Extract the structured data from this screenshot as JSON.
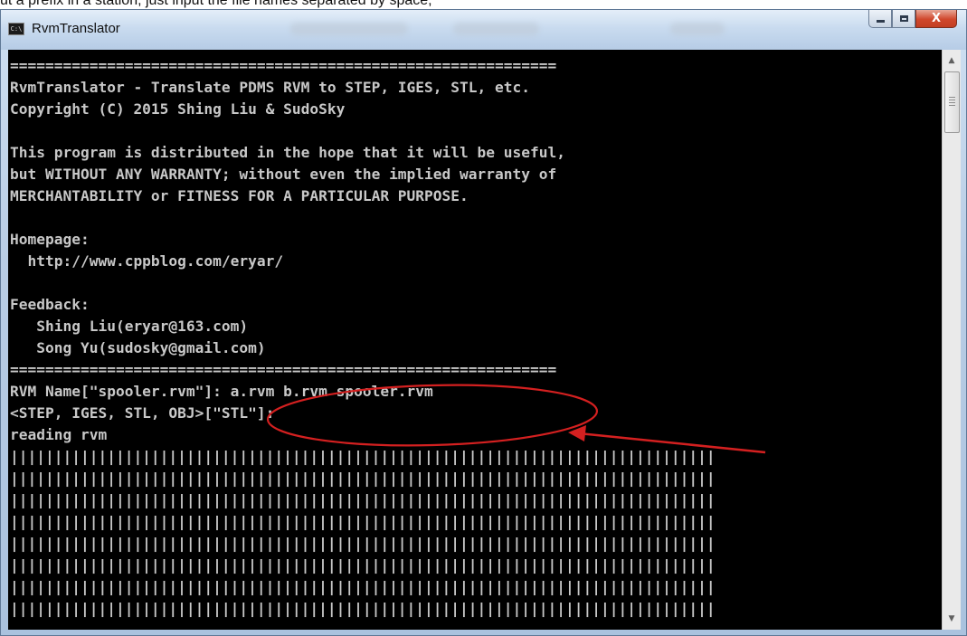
{
  "page_caption": "ut a prefix in a station, just input the file names separated by space,",
  "window": {
    "title": "RvmTranslator",
    "icon_text": "C:\\",
    "buttons": {
      "minimize": "minimize",
      "maximize": "maximize",
      "close_label": "X"
    }
  },
  "console": {
    "background": "#000000",
    "text_color": "#c8c8c8",
    "lines": [
      "==============================================================",
      "RvmTranslator - Translate PDMS RVM to STEP, IGES, STL, etc.",
      "Copyright (C) 2015 Shing Liu & SudoSky",
      "",
      "This program is distributed in the hope that it will be useful,",
      "but WITHOUT ANY WARRANTY; without even the implied warranty of",
      "MERCHANTABILITY or FITNESS FOR A PARTICULAR PURPOSE.",
      "",
      "Homepage:",
      "  http://www.cppblog.com/eryar/",
      "",
      "Feedback:",
      "   Shing Liu(eryar@163.com)",
      "   Song Yu(sudosky@gmail.com)",
      "==============================================================",
      "RVM Name[\"spooler.rvm\"]: a.rvm b.rvm spooler.rvm",
      "<STEP, IGES, STL, OBJ>[\"STL\"]:",
      "reading rvm",
      "||||||||||||||||||||||||||||||||||||||||||||||||||||||||||||||||||||||||||||||||",
      "||||||||||||||||||||||||||||||||||||||||||||||||||||||||||||||||||||||||||||||||",
      "||||||||||||||||||||||||||||||||||||||||||||||||||||||||||||||||||||||||||||||||",
      "||||||||||||||||||||||||||||||||||||||||||||||||||||||||||||||||||||||||||||||||",
      "||||||||||||||||||||||||||||||||||||||||||||||||||||||||||||||||||||||||||||||||",
      "||||||||||||||||||||||||||||||||||||||||||||||||||||||||||||||||||||||||||||||||",
      "||||||||||||||||||||||||||||||||||||||||||||||||||||||||||||||||||||||||||||||||",
      "||||||||||||||||||||||||||||||||||||||||||||||||||||||||||||||||||||||||||||||||"
    ]
  },
  "annotation": {
    "color": "#d42020",
    "shapes": [
      "ellipse",
      "arrow"
    ]
  },
  "scrollbar": {
    "up_icon": "scroll-up-arrow-icon",
    "down_icon": "scroll-down-arrow-icon"
  }
}
